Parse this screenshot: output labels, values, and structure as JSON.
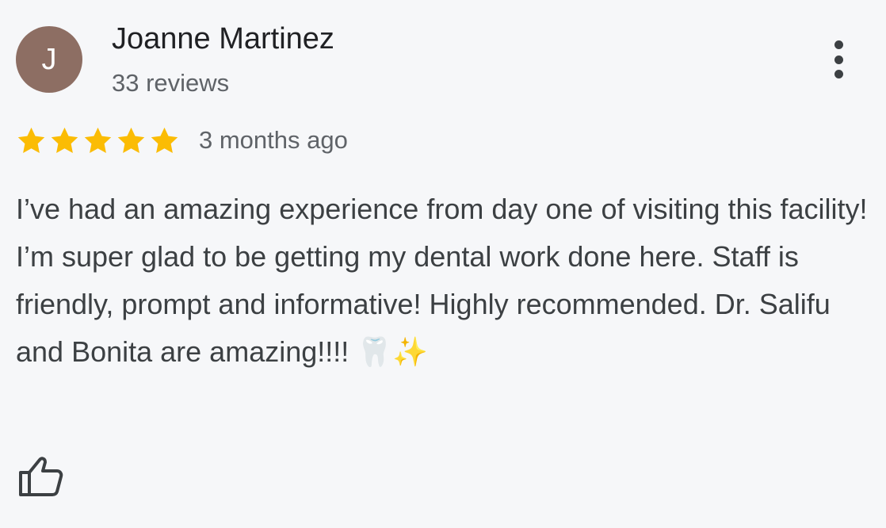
{
  "review": {
    "author": {
      "initial": "J",
      "name": "Joanne Martinez",
      "review_count": "33 reviews",
      "avatar_color": "#8d6e63"
    },
    "rating": 5,
    "rating_max": 5,
    "star_color": "#fbbc04",
    "date": "3 months ago",
    "text": "I’ve had an amazing experience from day one of visiting this facility! I’m super glad to be getting my dental work done here. Staff is friendly, prompt and informative! Highly recommended. Dr. Salifu and Bonita are amazing!!!! 🦷✨"
  },
  "icons": {
    "more": "more-vert-icon",
    "like": "thumb-up-icon",
    "star": "star-icon"
  }
}
